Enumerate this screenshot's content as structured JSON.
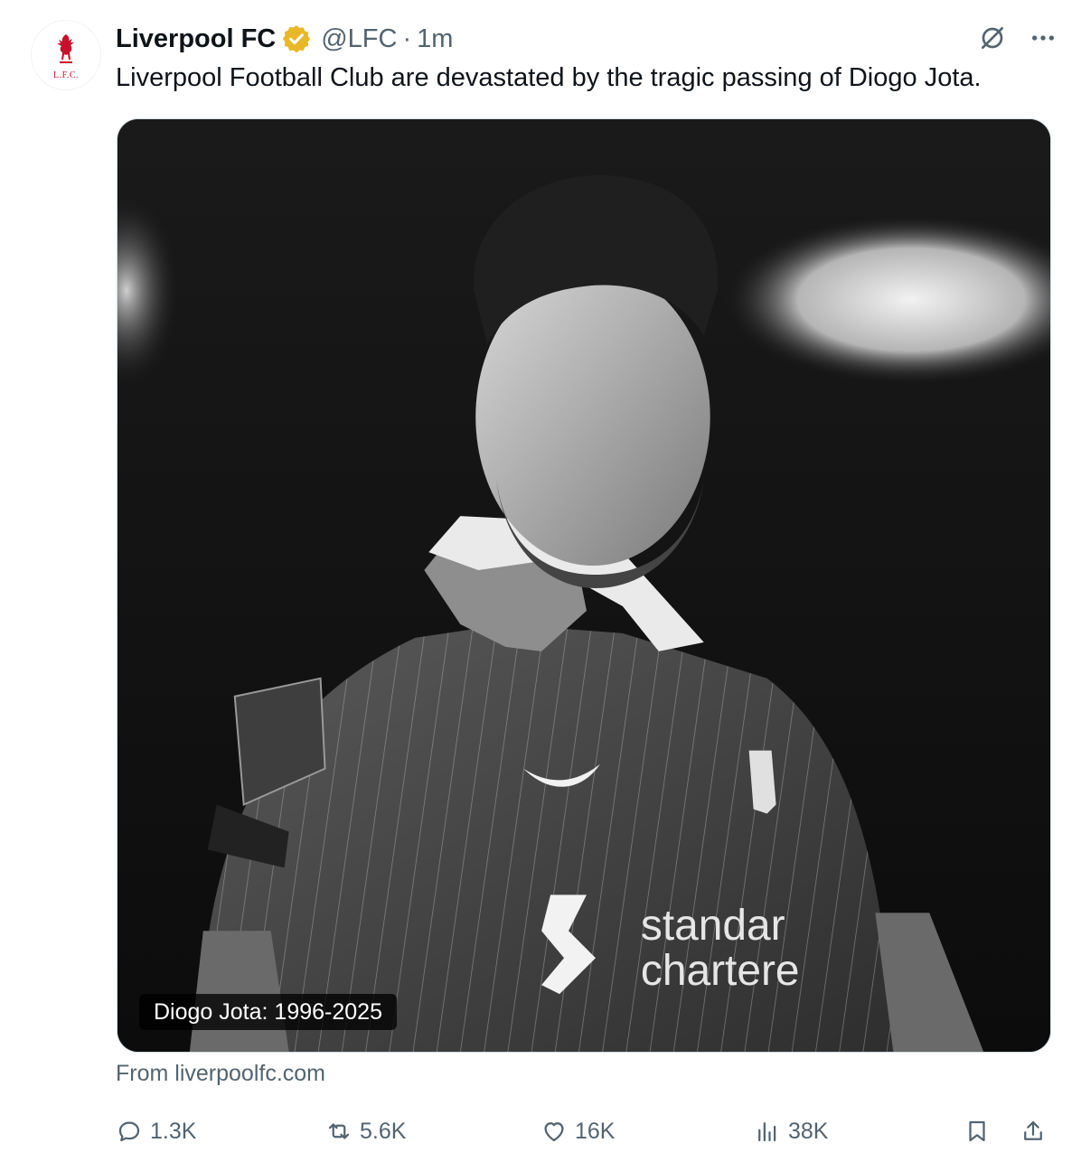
{
  "tweet": {
    "author_name": "Liverpool FC",
    "handle": "@LFC",
    "separator": "·",
    "time": "1m",
    "text": "Liverpool Football Club are devastated by the tragic passing of Diogo Jota.",
    "avatar_crest_text": "L.F.C.",
    "media": {
      "caption": "Diogo Jota: 1996-2025"
    },
    "source": "From liverpoolfc.com",
    "stats": {
      "replies": "1.3K",
      "reposts": "5.6K",
      "likes": "16K",
      "views": "38K"
    },
    "icons": {
      "verified": "verified-badge-icon",
      "grok": "grok-icon",
      "more": "more-icon",
      "reply": "reply-icon",
      "repost": "repost-icon",
      "like": "heart-icon",
      "views": "views-icon",
      "bookmark": "bookmark-icon",
      "share": "share-icon"
    },
    "colors": {
      "verified_badge": "#e8b829",
      "secondary_text": "#536471",
      "club_red": "#c8102e"
    }
  }
}
